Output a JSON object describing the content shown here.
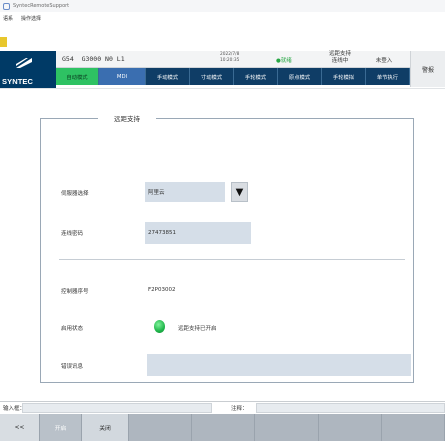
{
  "window": {
    "title": "SyntecRemoteSupport"
  },
  "menu": {
    "items": [
      "语系",
      "操作选择"
    ]
  },
  "header": {
    "logo_text": "SYNTEC",
    "gcode": "G54  G3000 N0 L1",
    "date": "2022/7/8",
    "time": "10:20:35",
    "ready": "●就绪",
    "remote_status_line1": "远距支持",
    "remote_status_line2": "连线中",
    "login": "未登入",
    "alarm": "警报",
    "modes": [
      "自动模式",
      "MDI",
      "手动模式",
      "寸动模式",
      "手轮模式",
      "原点模式",
      "手轮模拟",
      "单节执行"
    ]
  },
  "panel": {
    "title": "远距支持",
    "server_label": "伺服器选择",
    "server_value": "阿里云",
    "password_label": "连线密码",
    "password_value": "27473851",
    "controller_label": "控制器序号",
    "controller_value": "F2P03002",
    "status_label": "启用状态",
    "status_value": "远距支持已开启",
    "error_label": "错误讯息",
    "error_value": ""
  },
  "bottom": {
    "input_label": "输入框：",
    "note_label": "注释：",
    "softkeys": {
      "prev": "<<",
      "disabled": "开启",
      "close": "关闭"
    }
  },
  "colors": {
    "brand_navy": "#003a66",
    "active_mode": "#2ec263",
    "field_bg": "#d5dee8",
    "led_on": "#1fb54a"
  }
}
